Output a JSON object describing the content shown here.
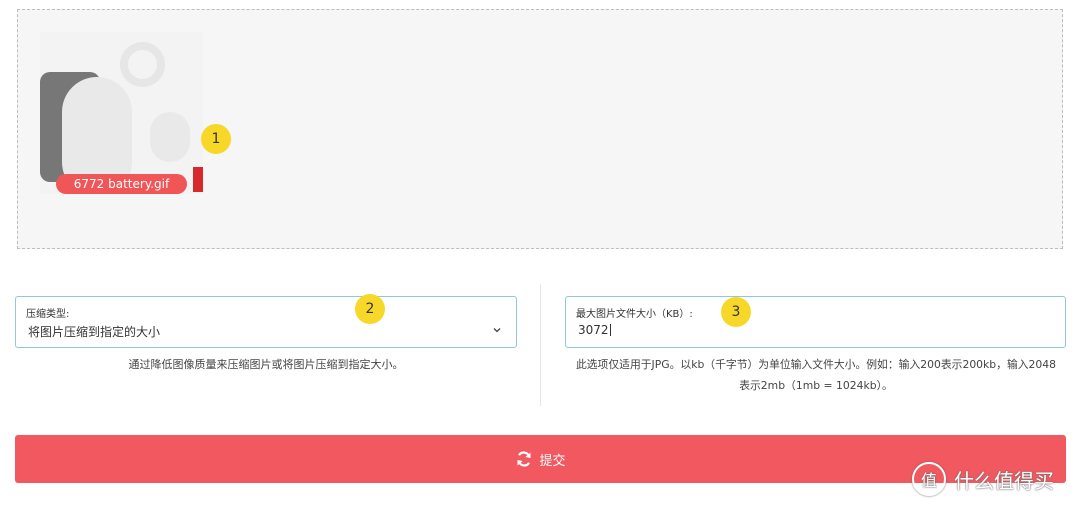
{
  "upload": {
    "file_name": "6772 battery.gif"
  },
  "markers": [
    "1",
    "2",
    "3"
  ],
  "compression_type": {
    "label": "压缩类型:",
    "selected": "将图片压缩到指定的大小",
    "help": "通过降低图像质量来压缩图片或将图片压缩到指定大小。"
  },
  "max_size": {
    "label": "最大图片文件大小（KB）:",
    "value": "3072",
    "help_line1": "此选项仅适用于JPG。以kb（千字节）为单位输入文件大小。例如：输入200表示200kb，输入2048",
    "help_line2": "表示2mb（1mb = 1024kb）。"
  },
  "submit": {
    "label": "提交"
  },
  "watermark": {
    "logo_glyph": "值",
    "text": "什么值得买"
  },
  "colors": {
    "submit_bg": "#f2585f",
    "badge_bg": "#f7d829",
    "pill_bg": "#f05658",
    "field_border": "#8fc6e6"
  }
}
